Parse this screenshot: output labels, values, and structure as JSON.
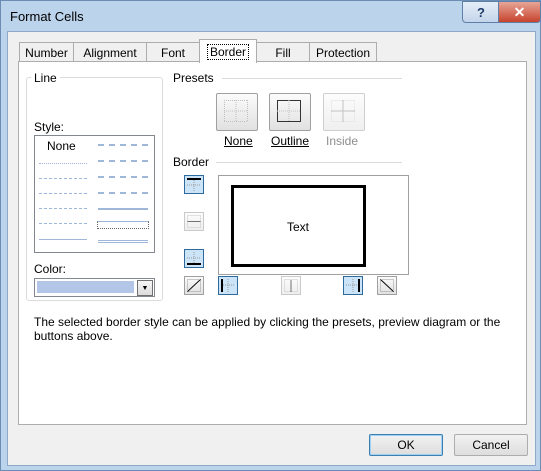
{
  "window": {
    "title": "Format Cells",
    "help_glyph": "?",
    "close_glyph": "✕"
  },
  "tabs": [
    "Number",
    "Alignment",
    "Font",
    "Border",
    "Fill",
    "Protection"
  ],
  "active_tab": "Border",
  "line": {
    "group_label": "Line",
    "style_label": "Style:",
    "none_label": "None",
    "color_label": "Color:",
    "color_value": "#b3c6e7"
  },
  "presets": {
    "label": "Presets",
    "items": [
      {
        "label": "None",
        "enabled": true
      },
      {
        "label": "Outline",
        "enabled": true
      },
      {
        "label": "Inside",
        "enabled": false
      }
    ]
  },
  "border": {
    "label": "Border",
    "preview_text": "Text"
  },
  "description": "The selected border style can be applied by clicking the presets, preview diagram or the buttons above.",
  "buttons": {
    "ok": "OK",
    "cancel": "Cancel"
  },
  "accent": "#2f6a9c"
}
